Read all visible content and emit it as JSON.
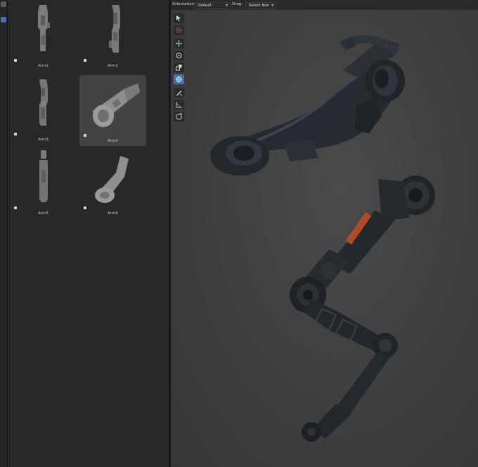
{
  "assets": [
    {
      "label": "Arm1",
      "selected": false
    },
    {
      "label": "Arm2",
      "selected": false
    },
    {
      "label": "Arm3",
      "selected": false
    },
    {
      "label": "Arm4",
      "selected": true
    },
    {
      "label": "Arm5",
      "selected": false
    },
    {
      "label": "Arm6",
      "selected": false
    }
  ],
  "viewport_header": {
    "orientation_label": "Orientation:",
    "orientation_value": "Default",
    "drag_label": "Drag:",
    "drag_value": "Select Box"
  },
  "tools": [
    {
      "name": "select-box-tool",
      "icon": "cursor-select-icon",
      "active": false
    },
    {
      "name": "cursor-tool",
      "icon": "3d-cursor-icon",
      "active": false
    },
    {
      "name": "move-tool",
      "icon": "move-icon",
      "active": false
    },
    {
      "name": "rotate-tool",
      "icon": "rotate-icon",
      "active": false
    },
    {
      "name": "scale-tool",
      "icon": "scale-icon",
      "active": false
    },
    {
      "name": "transform-tool",
      "icon": "transform-icon",
      "active": true
    },
    {
      "name": "annotate-tool",
      "icon": "annotate-pencil-icon",
      "active": false
    },
    {
      "name": "measure-tool",
      "icon": "measure-ruler-icon",
      "active": false
    },
    {
      "name": "add-cube-tool",
      "icon": "add-cube-icon",
      "active": false
    }
  ],
  "colors": {
    "accent": "#4772b3",
    "panel": "#282828",
    "viewport": "#404040"
  }
}
